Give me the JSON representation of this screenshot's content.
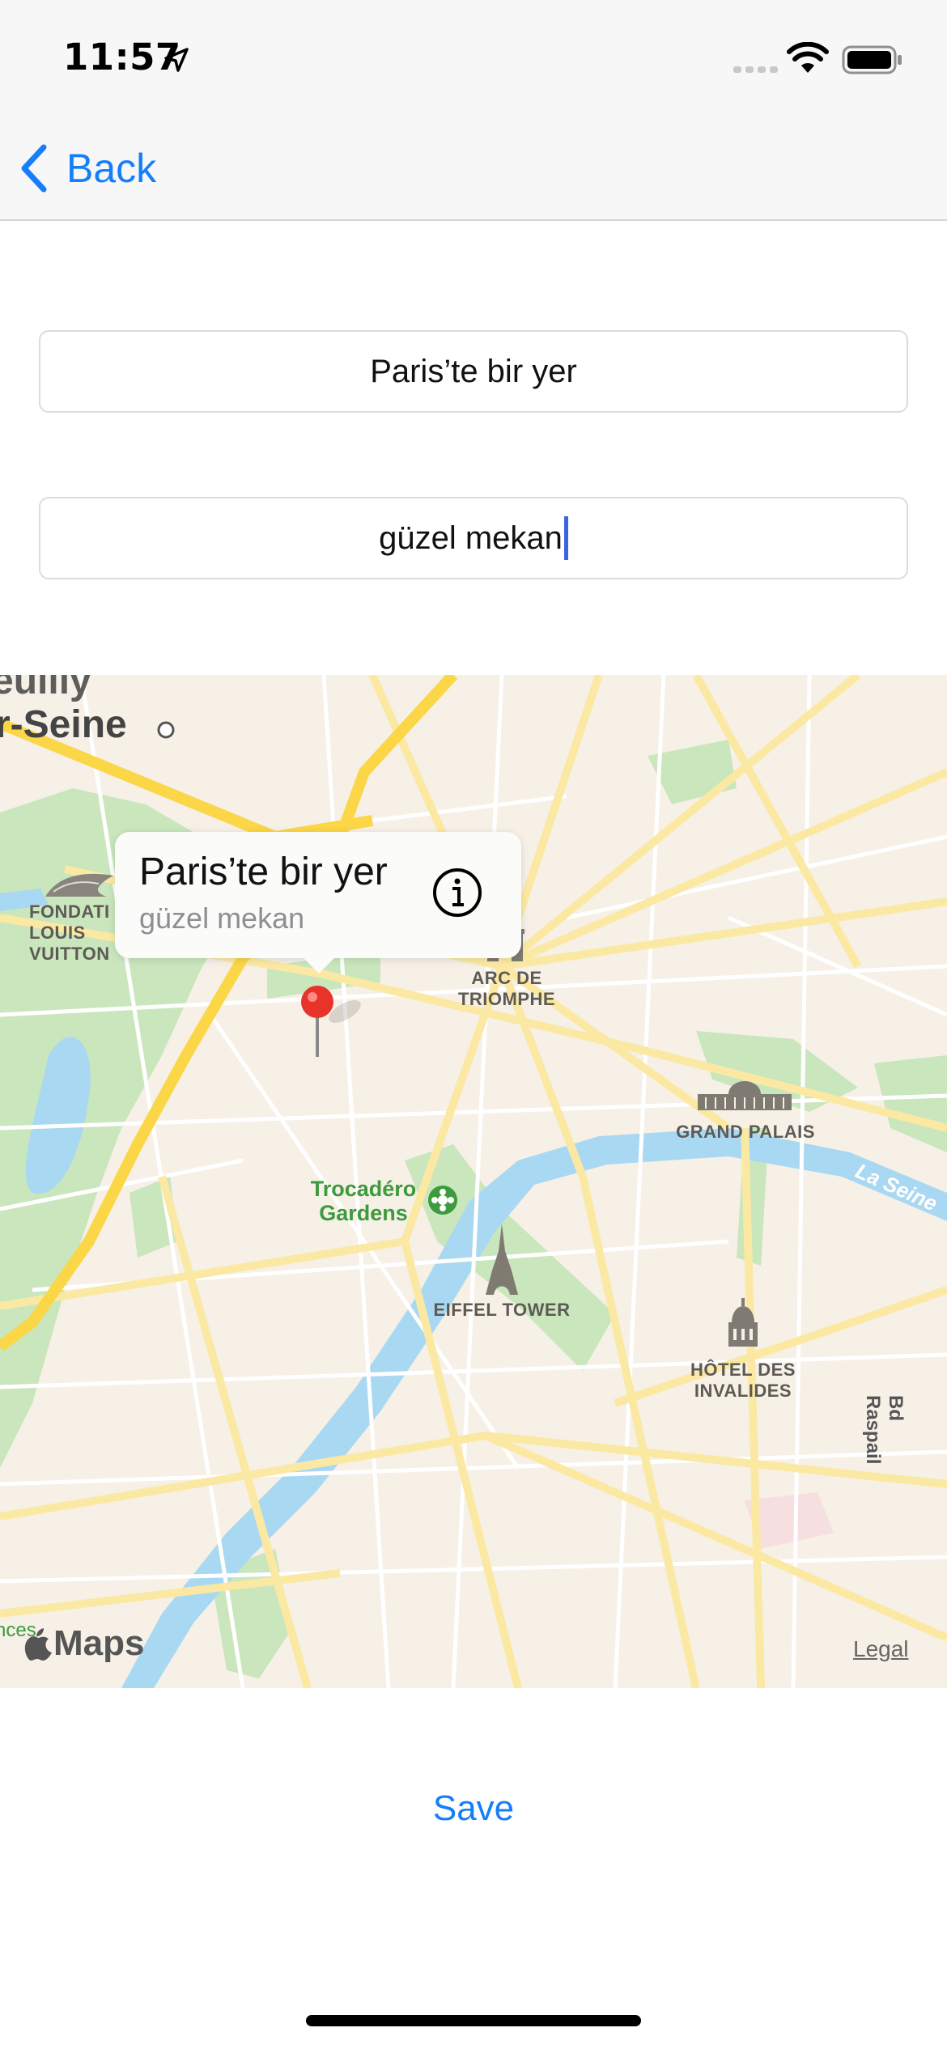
{
  "status_bar": {
    "time": "11:57"
  },
  "nav": {
    "back_label": "Back"
  },
  "form": {
    "title_value": "Paris’te bir yer",
    "subtitle_value": "güzel mekan"
  },
  "map": {
    "labels": {
      "city_partial": "r-Seine",
      "city_partial_top": "euilly",
      "fondation": [
        "FONDATI",
        "LOUIS",
        "VUITTON"
      ],
      "arc": [
        "ARC DE",
        "TRIOMPHE"
      ],
      "grand_palais": "GRAND PALAIS",
      "trocadero": [
        "Trocadéro",
        "Gardens"
      ],
      "eiffel": "EIFFEL TOWER",
      "invalides": [
        "HÔTEL DES",
        "INVALIDES"
      ],
      "la_seine": "La Seine",
      "bd_raspail": "Bd Raspail",
      "ences": "nces"
    },
    "callout": {
      "title": "Paris’te bir yer",
      "subtitle": "güzel mekan"
    },
    "attribution": "Maps",
    "legal": "Legal"
  },
  "actions": {
    "save_label": "Save"
  },
  "colors": {
    "accent": "#157efb",
    "pin": "#e8332b",
    "river": "#a9d8f2",
    "park": "#c9e6bd",
    "major_road": "#fbd647"
  }
}
